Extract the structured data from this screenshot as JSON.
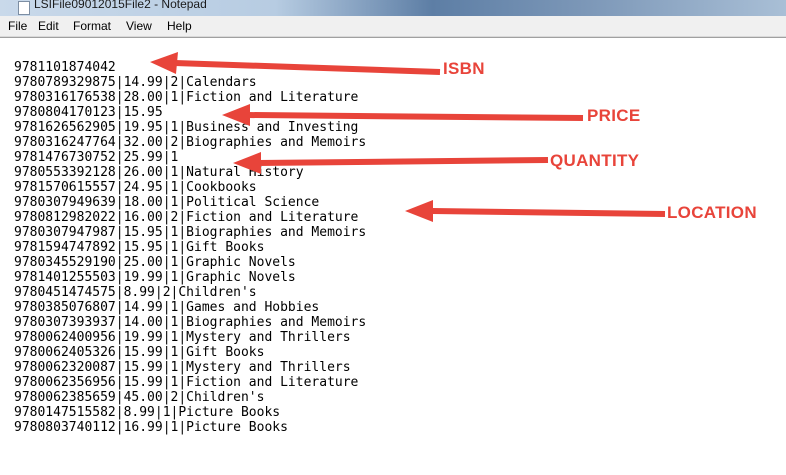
{
  "window": {
    "title": "LSIFile09012015File2 - Notepad"
  },
  "menu": [
    "File",
    "Edit",
    "Format",
    "View",
    "Help"
  ],
  "lines": [
    "9781101874042",
    "9780789329875|14.99|2|Calendars",
    "9780316176538|28.00|1|Fiction and Literature",
    "9780804170123|15.95",
    "9781626562905|19.95|1|Business and Investing",
    "9780316247764|32.00|2|Biographies and Memoirs",
    "9781476730752|25.99|1",
    "9780553392128|26.00|1|Natural History",
    "9781570615557|24.95|1|Cookbooks",
    "9780307949639|18.00|1|Political Science",
    "9780812982022|16.00|2|Fiction and Literature",
    "9780307947987|15.95|1|Biographies and Memoirs",
    "9781594747892|15.95|1|Gift Books",
    "9780345529190|25.00|1|Graphic Novels",
    "9781401255503|19.99|1|Graphic Novels",
    "9780451474575|8.99|2|Children's",
    "9780385076807|14.99|1|Games and Hobbies",
    "9780307393937|14.00|1|Biographies and Memoirs",
    "9780062400956|19.99|1|Mystery and Thrillers",
    "9780062405326|15.99|1|Gift Books",
    "9780062320087|15.99|1|Mystery and Thrillers",
    "9780062356956|15.99|1|Fiction and Literature",
    "9780062385659|45.00|2|Children's",
    "9780147515582|8.99|1|Picture Books",
    "9780803740112|16.99|1|Picture Books"
  ],
  "annotations": {
    "isbn": "ISBN",
    "price": "PRICE",
    "quantity": "QUANTITY",
    "location": "LOCATION"
  },
  "colors": {
    "annotation": "#e8443a"
  }
}
